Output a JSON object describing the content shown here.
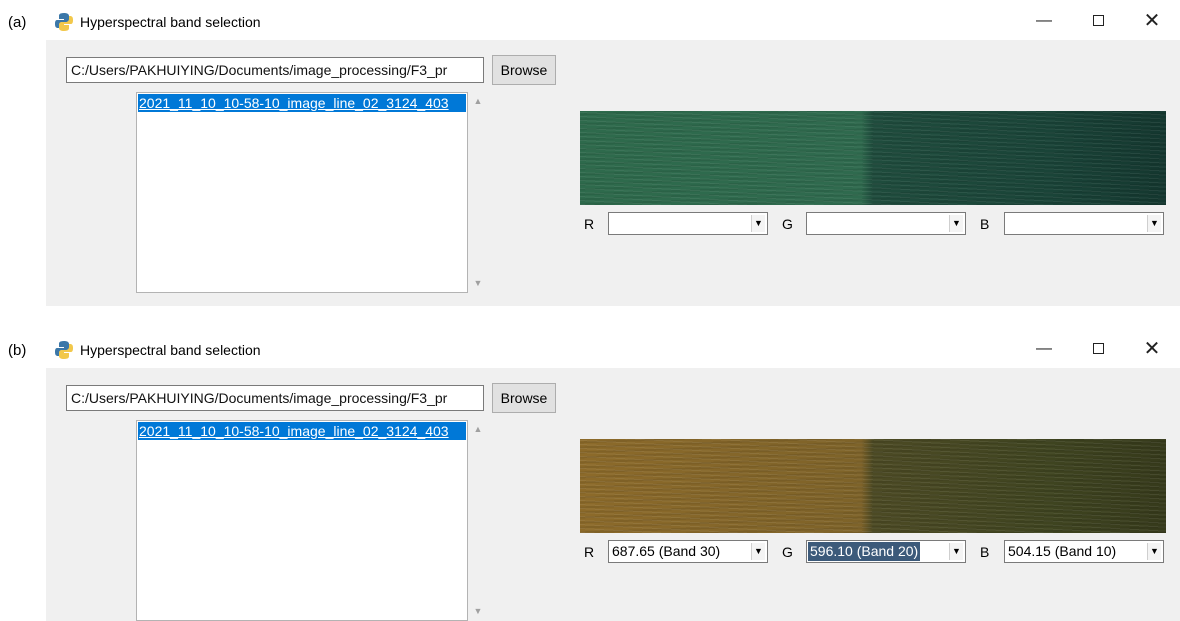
{
  "panels": [
    {
      "label": "(a)",
      "window_title": "Hyperspectral band selection",
      "path_value": "C:/Users/PAKHUIYING/Documents/image_processing/F3_pr",
      "browse_label": "Browse",
      "file_items": [
        "2021_11_10_10-58-10_image_line_02_3124_403"
      ],
      "bands": {
        "r_label": "R",
        "r_value": "",
        "g_label": "G",
        "g_value": "",
        "b_label": "B",
        "b_value": ""
      }
    },
    {
      "label": "(b)",
      "window_title": "Hyperspectral band selection",
      "path_value": "C:/Users/PAKHUIYING/Documents/image_processing/F3_pr",
      "browse_label": "Browse",
      "file_items": [
        "2021_11_10_10-58-10_image_line_02_3124_403"
      ],
      "bands": {
        "r_label": "R",
        "r_value": "687.65 (Band 30)",
        "g_label": "G",
        "g_value": "596.10 (Band 20)",
        "b_label": "B",
        "b_value": "504.15 (Band 10)"
      }
    }
  ],
  "window_controls": {
    "minimize": "—",
    "close": "✕"
  },
  "icons": {
    "app": "python-icon",
    "dropdown": "dropdown-arrow-icon"
  },
  "colors": {
    "selection": "#0078d7",
    "focus_selection": "#3c5a7a"
  }
}
